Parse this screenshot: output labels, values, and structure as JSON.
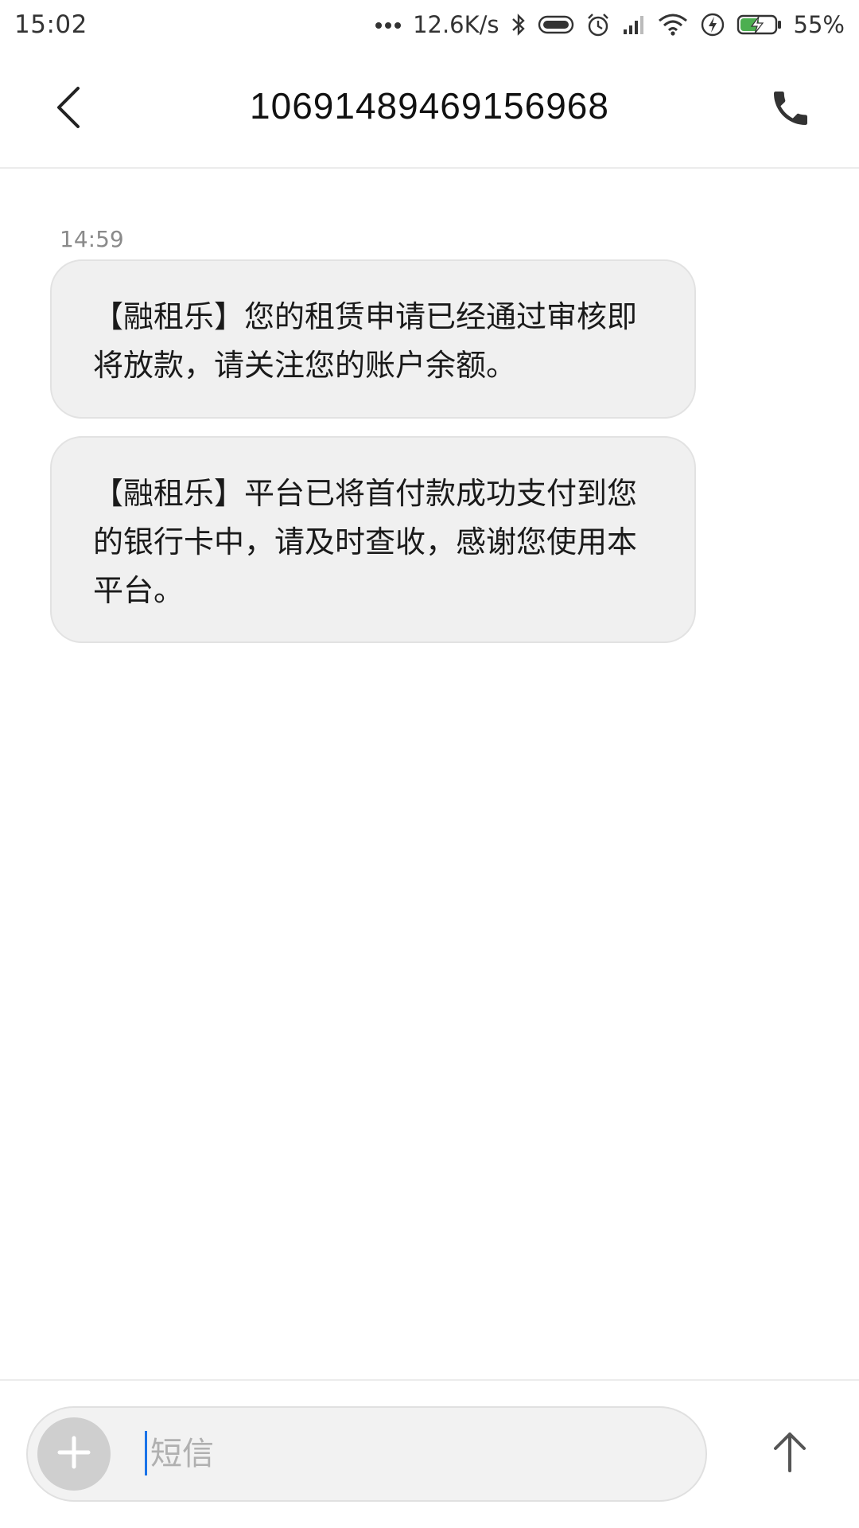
{
  "status_bar": {
    "time": "15:02",
    "more_icon": "more-dots-icon",
    "network_speed": "12.6K/s",
    "battery_percent": "55%",
    "battery_level": 55,
    "icons": [
      "bluetooth-icon",
      "toggle-icon",
      "alarm-icon",
      "signal-icon",
      "wifi-icon",
      "data-saver-icon",
      "battery-charging-icon"
    ]
  },
  "header": {
    "back_icon": "back-arrow-icon",
    "title": "10691489469156968",
    "call_icon": "phone-icon"
  },
  "conversation": {
    "timestamp": "14:59",
    "messages": [
      {
        "text": "【融租乐】您的租赁申请已经通过审核即将放款，请关注您的账户余额。"
      },
      {
        "text": "【融租乐】平台已将首付款成功支付到您的银行卡中，请及时查收，感谢您使用本平台。"
      }
    ]
  },
  "composer": {
    "add_icon": "plus-icon",
    "placeholder": "短信",
    "value": "",
    "send_icon": "send-arrow-icon"
  },
  "colors": {
    "bubble_bg": "#f0f0f0",
    "accent": "#1a73e8",
    "battery_green": "#4caf50"
  }
}
